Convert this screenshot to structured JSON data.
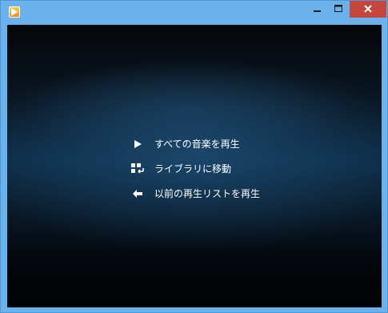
{
  "window": {
    "controls": {
      "minimize_icon": "minimize-icon",
      "maximize_icon": "maximize-icon",
      "close_icon": "close-icon",
      "close_color": "#c7463b"
    },
    "accent": "#69b2ec"
  },
  "menu": {
    "items": [
      {
        "label": "すべての音楽を再生",
        "icon": "play-icon"
      },
      {
        "label": "ライブラリに移動",
        "icon": "library-icon"
      },
      {
        "label": "以前の再生リストを再生",
        "icon": "back-arrow-icon"
      }
    ]
  }
}
